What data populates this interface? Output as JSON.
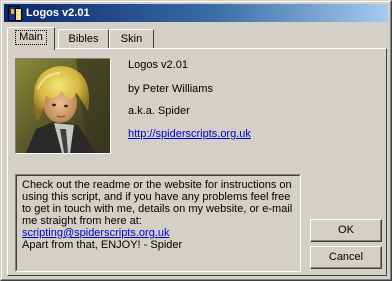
{
  "window": {
    "title": "Logos v2.01"
  },
  "tabs": [
    {
      "label": "Main",
      "active": true
    },
    {
      "label": "Bibles",
      "active": false
    },
    {
      "label": "Skin",
      "active": false
    }
  ],
  "about": {
    "app_name": "Logos v2.01",
    "author": "by Peter Williams",
    "alias": "a.k.a. Spider",
    "website": "http://spiderscripts.org.uk"
  },
  "readme": {
    "message": "Check out the readme or the website for instructions on using this script, and if you have any problems feel free to get in touch with me, details on my website, or e-mail me straight from here at:",
    "email": "scripting@spiderscripts.org.uk",
    "closing": "Apart from that, ENJOY!  - Spider"
  },
  "buttons": {
    "ok": "OK",
    "cancel": "Cancel"
  }
}
